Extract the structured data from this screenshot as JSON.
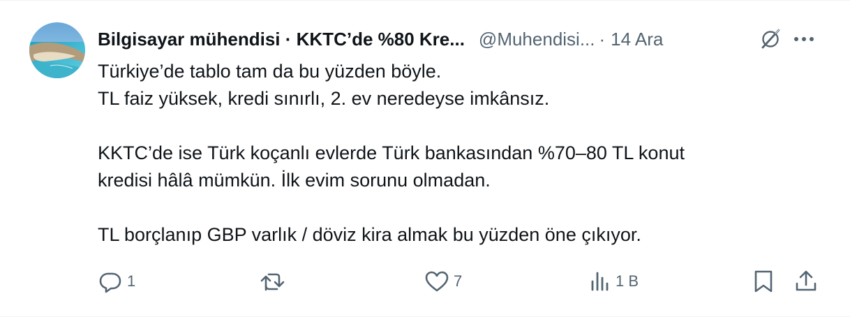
{
  "tweet": {
    "display_name": "Bilgisayar mühendisi · KKTC’de %80 Kre...",
    "handle": "@Muhendisi...",
    "separator": "·",
    "time": "14 Ara",
    "lines": [
      "Türkiye’de tablo tam da bu yüzden böyle.",
      "TL faiz yüksek, kredi sınırlı, 2. ev neredeyse imkânsız.",
      "",
      "KKTC’de ise Türk koçanlı evlerde Türk bankasından %70–80 TL konut",
      "kredisi hâlâ mümkün. İlk evim sorunu olmadan.",
      "",
      "TL borçlanıp GBP varlık / döviz kira almak bu yüzden öne çıkıyor."
    ]
  },
  "actions": {
    "reply_count": "1",
    "retweet_count": "",
    "like_count": "7",
    "views_count": "1 B"
  },
  "icons": {
    "reply": "reply-icon",
    "retweet": "retweet-icon",
    "like": "heart-icon",
    "views": "views-icon",
    "bookmark": "bookmark-icon",
    "share": "share-icon",
    "grok": "grok-icon",
    "more": "more-icon"
  },
  "colors": {
    "text_primary": "#0f1419",
    "text_secondary": "#536471",
    "border": "#eff3f4"
  }
}
